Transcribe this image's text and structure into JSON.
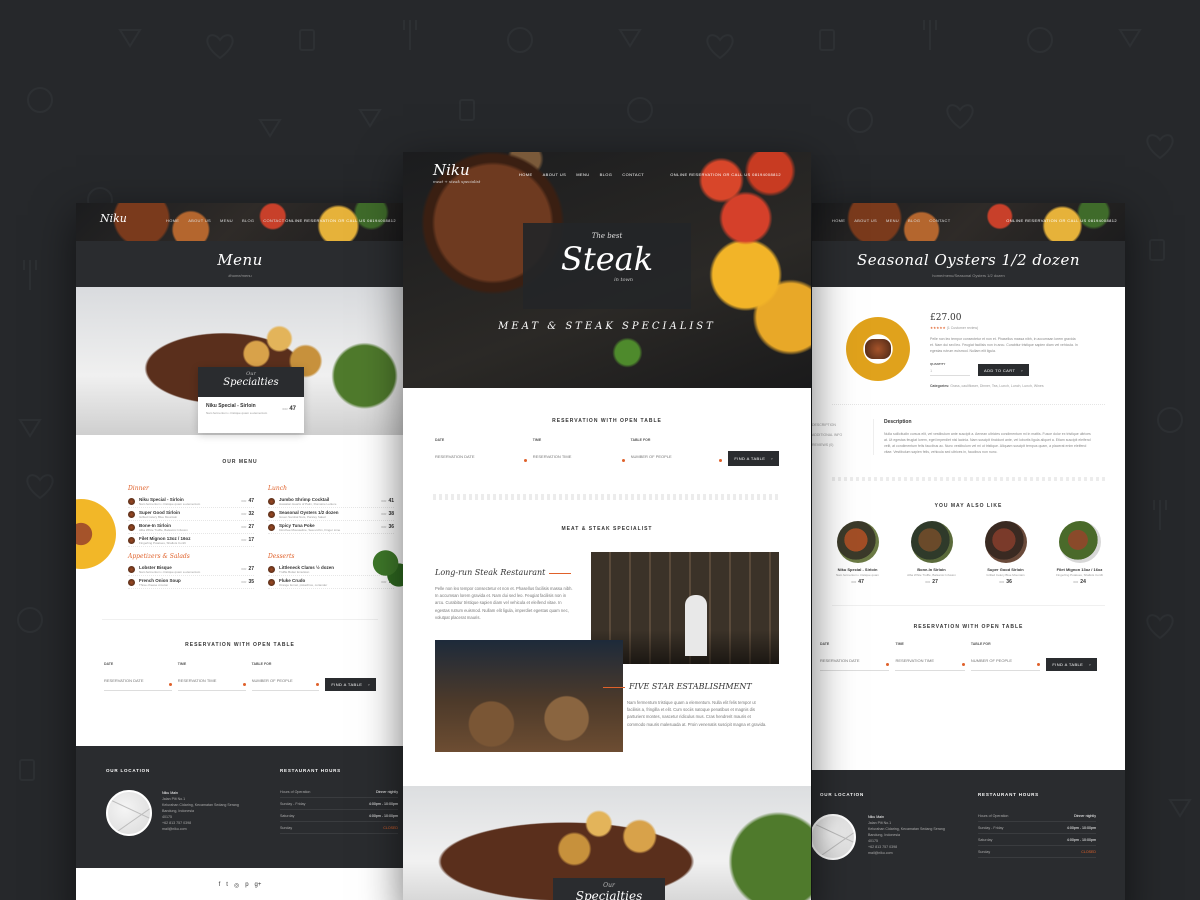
{
  "brand": {
    "name": "Niku",
    "tagline": "meat + steak specialist"
  },
  "nav": {
    "items": [
      "HOME",
      "ABOUT US",
      "MENU",
      "BLOG",
      "CONTACT"
    ],
    "reservation": "ONLINE RESERVATION",
    "or": "OR",
    "call": "CALL US 08194008812"
  },
  "left_page": {
    "title": "Menu",
    "subtitle": "#home/menu",
    "specialties": {
      "our": "Our",
      "label": "Specialties",
      "item_name": "Niku Special - Sirloin",
      "item_desc": "Nam fermentum • tristique quam a elementum",
      "price": "47"
    },
    "menu_heading": "OUR MENU",
    "categories": [
      {
        "name": "Dinner",
        "items": [
          {
            "name": "Niku Special - Sirloin",
            "desc": "Nam fermentum • tristique quam a elementum",
            "price": "47"
          },
          {
            "name": "Super Good Sirloin",
            "desc": "Grilled Celery Blue Mountain",
            "price": "32"
          },
          {
            "name": "Bone-In Sirloin",
            "desc": "Alba White Truffle, Balsamic Infusion",
            "price": "27"
          },
          {
            "name": "Filet Mignon 13oz / 16oz",
            "desc": "Fingerling Potatoes, Shallots Confit",
            "price": "17"
          }
        ]
      },
      {
        "name": "Lunch",
        "items": [
          {
            "name": "Jumbo Shrimp Cocktail",
            "desc": "Hawaiian Hearts of Palm, Romaine Lettuce",
            "price": "41"
          },
          {
            "name": "Seasonal Oysters 1/2 dozen",
            "desc": "Green Sambal Nuts, Parsley Salad",
            "price": "38"
          },
          {
            "name": "Spicy Tuna Poke",
            "desc": "Kimchee Mousseline, Sea urchin, Finger Lime",
            "price": "36"
          }
        ]
      },
      {
        "name": "Appetizers & Salads",
        "items": [
          {
            "name": "Lobster Bisque",
            "desc": "Nam fermentum • tristique quam a elementum",
            "price": "27"
          },
          {
            "name": "French Onion Soup",
            "desc": "Three cheese crouton",
            "price": "35"
          }
        ]
      },
      {
        "name": "Desserts",
        "items": [
          {
            "name": "Littleneck Clams ½ dozen",
            "desc": "Truffle Butter Emulsion",
            "price": "31"
          },
          {
            "name": "Fluke Crudo",
            "desc": "Orange fennel, pistachios, coriander",
            "price": "78"
          }
        ]
      }
    ],
    "currency": "IDR",
    "reservation": {
      "title": "RESERVATION WITH OPEN TABLE",
      "date_label": "DATE",
      "date_placeholder": "RESERVATION DATE",
      "time_label": "TIME",
      "time_placeholder": "RESERVATION TIME",
      "table_label": "TABLE FOR",
      "table_placeholder": "NUMBER OF PEOPLE",
      "button": "FIND A TABLE"
    },
    "footer": {
      "location_title": "OUR LOCATION",
      "place": "Niku Main",
      "address": [
        "Jalan Pilt No.1",
        "Kelurahan Cidaring, Kecamatan Sedang Serang",
        "Bandung, Indonesia",
        "40175"
      ],
      "phone": "+62 813 757 0398",
      "email": "mail@niku.com",
      "hours_title": "RESTAURANT HOURS",
      "hours": [
        {
          "day": "Hours of Operation",
          "value": "Dinner nightly"
        },
        {
          "day": "Sunday - Friday",
          "value": "4:00pm - 10:00pm"
        },
        {
          "day": "Saturday",
          "value": "4:00pm - 10:00pm"
        },
        {
          "day": "Sunday",
          "value": "CLOSED"
        }
      ]
    }
  },
  "center_page": {
    "hero": {
      "best": "The best",
      "steak": "Steak",
      "intown": "in town",
      "tagline": "MEAT & STEAK SPECIALIST"
    },
    "reservation": {
      "title": "RESERVATION WITH OPEN TABLE",
      "date_label": "DATE",
      "date_placeholder": "RESERVATION DATE",
      "time_label": "TIME",
      "time_placeholder": "RESERVATION TIME",
      "table_label": "TABLE FOR",
      "table_placeholder": "NUMBER OF PEOPLE",
      "button": "FIND A TABLE"
    },
    "specialist_heading": "MEAT & STEAK SPECIALIST",
    "story1": {
      "title": "Long-run Steak Restaurant",
      "text": "Pelle non leo tempor consectetur et non et. Phasellus facilisis massa nibh. In accumsan lorem gravida et. Nam dui sed leo. Feugiat facilisis non in arcu. Curabitur tristique sapien diam vel vehicula et eleifend vitae. In egestas rutrum euismod. Nullam elit ligula, imperdiet egestas quam nec, volutpat placerat mauris."
    },
    "story2": {
      "title": "FIVE STAR ESTABLISHMENT",
      "text": "Nam fermentum tristique quam a elementum. Nulla elit felis tempor ut facilisis a, fringilla et elit. Cum sociis natoque penatibus et magnis dis parturient montes, nascetur ridiculus mus. Cras hendrerit mauris et commodo mauris malesuada at. Proin venenatis suscipit magna et gravida."
    },
    "specialties": {
      "our": "Our",
      "label": "Specialties"
    }
  },
  "right_page": {
    "title": "Seasonal Oysters 1/2 dozen",
    "subtitle": "home/menu/Seasonal Oysters 1/2 dozen",
    "price": "£27.00",
    "reviews": "(1 Customer review)",
    "description_short": "Pelle non leo tempor consectetur et non et. Phasellus massa nibh, in accumsan lorem gravida et. Nam dui sed leo. Feugiat facilisis non in arcu. Curabitur tristique sapien diam vel vehicula. In egestas rutrum euismod. Nullam elit ligula.",
    "quantity_label": "QUANTITY",
    "quantity_value": "1",
    "add_to_cart": "ADD TO CART",
    "categories_label": "Categories:",
    "categories_value": "Grass, cauliflower, Dinner, Tea, Lunch, Lunch, Lunch, Wines",
    "tabs": [
      "DESCRIPTION",
      "ADDITIONAL INFO",
      "REVIEWS (0)"
    ],
    "description_title": "Description",
    "description": "Nulla sollicitudin cursus elit, vel vestibulum ante suscipit a. Aenean ultricies condimentum mi in mattis. Fusce dolor ex tristique ultrices at. Ut egestas feugiat lorem, eget imperdiet nisl lacinia. Nam suscipit tincidunt ante, vel lobortis ligula aliquet a. Etiam suscipit eleifend velit, at condimentum felis faucibus ac. Nunc vestibulum vel mi ut tristique. Aliquam suscipit tempus quam, a placerat enim eleifend vitae. Vestibulum sapien felis, vehicula sed ultrices in, faucibus non nunc.",
    "also_like_title": "YOU MAY ALSO LIKE",
    "also_like": [
      {
        "name": "Niku Special - Sirloin",
        "desc": "Nam fermentum • tristique quam",
        "price": "47"
      },
      {
        "name": "Bone-In Sirloin",
        "desc": "Alba White Truffle, Balsamic Infusion",
        "price": "27"
      },
      {
        "name": "Super Good Sirloin",
        "desc": "Grilled Celery Blue Mountain",
        "price": "36"
      },
      {
        "name": "Filet Mignon 13oz / 16oz",
        "desc": "Fingerling Potatoes, Shallots Confit",
        "price": "24"
      }
    ],
    "currency": "IDR"
  },
  "colors": {
    "accent": "#e0612a",
    "dark": "#2a2c2f",
    "background": "#26282b"
  }
}
